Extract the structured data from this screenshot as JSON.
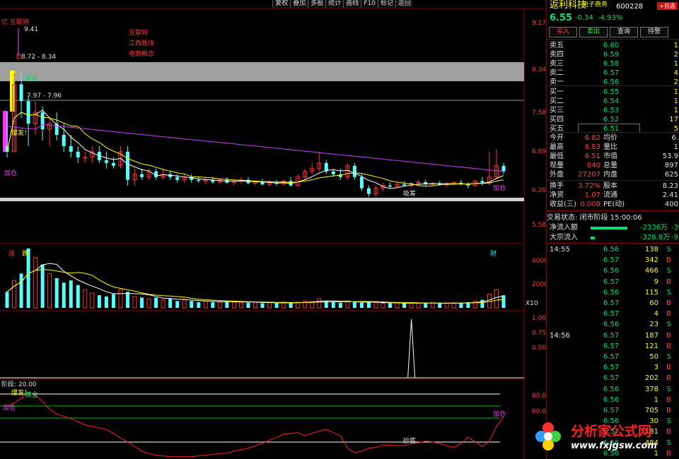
{
  "chart": {
    "site_title": "亿 互联网",
    "concepts": [
      "互联网",
      "江西板块",
      "电商概念"
    ],
    "price_high_label": "9.41",
    "range1": "8.72 - 8.34",
    "range2": "7.97 - 7.96",
    "marker_rise_tag": "涨",
    "marker_fall_tag": "跌",
    "marker_fin_tag": "财",
    "signal_explode": "爆发！",
    "signal_add": "加仓",
    "signal_absorb": "吸筹",
    "signal_gold": "黄金",
    "signal_bottom": "抄底",
    "osc_title": "阶段: 20.00",
    "vol_unit": "X10",
    "price_ticks": [
      "9.17",
      "8.34",
      "7.58",
      "6.89",
      "6.20",
      "5.58"
    ],
    "vol_ticks": [
      "40000",
      "20000"
    ],
    "ind_ticks": [
      "1.00",
      "0.75",
      "0.50"
    ],
    "osc_ticks": [
      "80.00",
      "60.00"
    ],
    "colors": {
      "up": "#ff3232",
      "down": "#54ffff",
      "ma5": "#ffffff",
      "ma10": "#ffff00",
      "ma60": "#cc40ff",
      "border": "#8b0000"
    }
  },
  "chart_data": {
    "type": "candlestick",
    "candles": [
      [
        7.0,
        7.6,
        6.8,
        6.9
      ],
      [
        6.9,
        8.3,
        6.9,
        8.1
      ],
      [
        8.1,
        8.3,
        7.5,
        7.8
      ],
      [
        7.8,
        7.9,
        7.0,
        7.4
      ],
      [
        7.4,
        7.8,
        7.2,
        7.6
      ],
      [
        7.6,
        7.7,
        7.1,
        7.3
      ],
      [
        7.3,
        7.5,
        7.0,
        7.4
      ],
      [
        7.4,
        7.6,
        7.1,
        7.2
      ],
      [
        7.2,
        7.4,
        6.9,
        7.0
      ],
      [
        7.0,
        7.2,
        6.8,
        6.9
      ],
      [
        6.9,
        7.0,
        6.7,
        6.8
      ],
      [
        6.8,
        6.9,
        6.7,
        6.8
      ],
      [
        6.8,
        7.0,
        6.7,
        6.9
      ],
      [
        6.9,
        7.0,
        6.7,
        6.75
      ],
      [
        6.75,
        6.9,
        6.6,
        6.7
      ],
      [
        6.7,
        6.8,
        6.6,
        6.65
      ],
      [
        6.65,
        7.0,
        6.6,
        6.9
      ],
      [
        6.9,
        7.0,
        6.3,
        6.4
      ],
      [
        6.4,
        6.6,
        6.3,
        6.5
      ],
      [
        6.5,
        6.6,
        6.4,
        6.45
      ],
      [
        6.45,
        6.6,
        6.4,
        6.55
      ],
      [
        6.55,
        6.6,
        6.4,
        6.45
      ],
      [
        6.45,
        6.6,
        6.4,
        6.5
      ],
      [
        6.5,
        6.55,
        6.4,
        6.45
      ],
      [
        6.45,
        6.5,
        6.35,
        6.4
      ],
      [
        6.4,
        6.5,
        6.35,
        6.45
      ],
      [
        6.45,
        6.5,
        6.35,
        6.4
      ],
      [
        6.4,
        6.45,
        6.35,
        6.38
      ],
      [
        6.38,
        6.45,
        6.32,
        6.4
      ],
      [
        6.4,
        6.45,
        6.33,
        6.36
      ],
      [
        6.36,
        6.42,
        6.32,
        6.4
      ],
      [
        6.4,
        6.45,
        6.33,
        6.35
      ],
      [
        6.35,
        6.42,
        6.3,
        6.38
      ],
      [
        6.38,
        6.45,
        6.33,
        6.4
      ],
      [
        6.4,
        6.45,
        6.32,
        6.34
      ],
      [
        6.34,
        6.4,
        6.3,
        6.37
      ],
      [
        6.37,
        6.42,
        6.3,
        6.32
      ],
      [
        6.32,
        6.4,
        6.28,
        6.35
      ],
      [
        6.35,
        6.4,
        6.3,
        6.33
      ],
      [
        6.33,
        6.4,
        6.3,
        6.38
      ],
      [
        6.38,
        6.45,
        6.28,
        6.3
      ],
      [
        6.3,
        6.5,
        6.28,
        6.45
      ],
      [
        6.45,
        6.6,
        6.4,
        6.55
      ],
      [
        6.55,
        6.7,
        6.5,
        6.6
      ],
      [
        6.6,
        6.9,
        6.55,
        6.7
      ],
      [
        6.7,
        6.75,
        6.5,
        6.55
      ],
      [
        6.55,
        6.6,
        6.45,
        6.5
      ],
      [
        6.5,
        6.6,
        6.4,
        6.45
      ],
      [
        6.45,
        6.7,
        6.4,
        6.65
      ],
      [
        6.65,
        6.7,
        6.4,
        6.45
      ],
      [
        6.45,
        6.5,
        6.2,
        6.25
      ],
      [
        6.25,
        6.3,
        6.1,
        6.15
      ],
      [
        6.15,
        6.3,
        6.1,
        6.25
      ],
      [
        6.25,
        6.35,
        6.2,
        6.3
      ],
      [
        6.3,
        6.35,
        6.25,
        6.28
      ],
      [
        6.28,
        6.35,
        6.25,
        6.32
      ],
      [
        6.32,
        6.38,
        6.28,
        6.3
      ],
      [
        6.3,
        6.36,
        6.26,
        6.34
      ],
      [
        6.34,
        6.4,
        6.3,
        6.36
      ],
      [
        6.36,
        6.4,
        6.3,
        6.32
      ],
      [
        6.32,
        6.36,
        6.28,
        6.34
      ],
      [
        6.34,
        6.38,
        6.3,
        6.31
      ],
      [
        6.31,
        6.36,
        6.27,
        6.33
      ],
      [
        6.33,
        6.38,
        6.3,
        6.35
      ],
      [
        6.35,
        6.4,
        6.3,
        6.32
      ],
      [
        6.32,
        6.36,
        6.25,
        6.3
      ],
      [
        6.3,
        6.4,
        6.28,
        6.38
      ],
      [
        6.38,
        6.45,
        6.3,
        6.35
      ],
      [
        6.35,
        6.9,
        6.3,
        6.45
      ],
      [
        6.45,
        6.95,
        6.4,
        6.65
      ],
      [
        6.65,
        6.7,
        6.5,
        6.55
      ]
    ],
    "ylim": [
      5.58,
      9.41
    ],
    "volumes": [
      14000,
      24000,
      30000,
      52000,
      44000,
      38000,
      30000,
      26000,
      22000,
      24000,
      20000,
      16000,
      13000,
      11000,
      10000,
      12000,
      16000,
      14000,
      10000,
      9000,
      8000,
      9000,
      7000,
      8000,
      6000,
      7000,
      6000,
      5000,
      6000,
      5000,
      5000,
      6000,
      5000,
      5000,
      4500,
      5000,
      4000,
      4500,
      4000,
      5000,
      4000,
      5000,
      6000,
      5500,
      8000,
      6000,
      5000,
      4500,
      6000,
      5000,
      4500,
      5000,
      4500,
      4000,
      4000,
      4500,
      4000,
      4500,
      4000,
      4000,
      4500,
      4000,
      4000,
      4500,
      4000,
      5000,
      6000,
      7000,
      12000,
      16000,
      11000
    ],
    "vol_ylim": [
      0,
      50000
    ],
    "indicator": [
      0,
      0,
      0,
      0,
      0,
      0,
      0,
      0,
      0,
      0,
      0,
      0,
      0,
      0,
      0,
      0,
      0,
      0,
      0,
      0,
      0,
      0,
      0,
      0,
      0,
      0,
      0,
      0,
      0,
      0,
      0,
      0,
      0,
      0,
      0,
      0,
      0,
      0,
      0,
      0,
      0,
      0,
      0,
      0,
      0,
      0,
      0,
      0,
      0,
      0,
      0,
      0,
      0,
      0,
      0,
      0,
      0,
      1,
      0,
      0,
      0,
      0,
      0,
      0,
      0,
      0,
      0,
      0,
      0,
      0,
      0
    ],
    "ind_ylim": [
      0,
      1.0
    ],
    "oscillator": [
      68,
      72,
      78,
      85,
      82,
      74,
      64,
      58,
      55,
      52,
      48,
      44,
      42,
      40,
      38,
      33,
      27,
      22,
      16,
      10,
      7,
      5,
      4,
      3,
      3,
      3,
      3,
      4,
      5,
      6,
      7,
      8,
      10,
      12,
      14,
      17,
      20,
      24,
      28,
      32,
      33,
      34,
      30,
      33,
      36,
      38,
      34,
      30,
      14,
      8,
      10,
      14,
      15,
      18,
      18,
      17,
      17,
      20,
      21,
      23,
      22,
      20,
      17,
      15,
      20,
      28,
      22,
      16,
      23,
      42,
      54
    ],
    "osc_ylim": [
      0,
      100
    ]
  },
  "panel": {
    "name": "返利科技",
    "code": "600228",
    "tag": "电子商务",
    "add_btn": "+自选",
    "price": "6.55",
    "change": "-0.34",
    "pct": "-4.93%",
    "buttons": [
      "买入",
      "卖出",
      "查询",
      "持警"
    ],
    "asks": [
      [
        "卖五",
        "6.60",
        "1"
      ],
      [
        "卖四",
        "6.59",
        "2"
      ],
      [
        "卖三",
        "6.58",
        "1"
      ],
      [
        "卖二",
        "6.57",
        "4"
      ],
      [
        "卖一",
        "6.56",
        "2"
      ]
    ],
    "bids": [
      [
        "买一",
        "6.55",
        "1"
      ],
      [
        "买二",
        "6.54",
        "1"
      ],
      [
        "买三",
        "6.53",
        "1"
      ],
      [
        "买四",
        "6.52",
        "17"
      ],
      [
        "买五",
        "6.51",
        "5"
      ]
    ],
    "stats": [
      [
        "今开",
        "6.82",
        "均价",
        "6."
      ],
      [
        "最高",
        "6.83",
        "量比",
        "1"
      ],
      [
        "最低",
        "6.51",
        "市值",
        "53.9"
      ],
      [
        "现量",
        "840",
        "总量",
        "897"
      ],
      [
        "外盘",
        "27207",
        "内盘",
        "625"
      ]
    ],
    "stats2": [
      [
        "换手",
        "3.72%",
        "股本",
        "8.23"
      ],
      [
        "净资",
        "1.07",
        "流通",
        "2.41"
      ],
      [
        "收益(三)",
        "0.008",
        "PE(动)",
        "400"
      ]
    ],
    "trade_state": "交易状态: 闭市阶段 15:00:06",
    "netflow_label": "净流入额",
    "netflow_val": "-2336万",
    "netflow_tail": "-39",
    "block_label": "大宗流入",
    "block_val": "-326.8万",
    "block_tail": "-9",
    "ticks": [
      [
        "14:55",
        "6.56",
        "138",
        "S"
      ],
      [
        "",
        "6.57",
        "342",
        "B"
      ],
      [
        "",
        "6.56",
        "466",
        "S"
      ],
      [
        "",
        "6.57",
        "9",
        "B"
      ],
      [
        "",
        "6.56",
        "115",
        "S"
      ],
      [
        "",
        "6.57",
        "60",
        "B"
      ],
      [
        "",
        "6.57",
        "4",
        "B"
      ],
      [
        "",
        "6.56",
        "23",
        "S"
      ],
      [
        "14:56",
        "6.57",
        "187",
        "B"
      ],
      [
        "",
        "6.57",
        "121",
        "B"
      ],
      [
        "",
        "6.57",
        "50",
        "S"
      ],
      [
        "",
        "6.57",
        "3",
        "B"
      ],
      [
        "",
        "6.57",
        "202",
        "B"
      ],
      [
        "",
        "6.56",
        "378",
        "S"
      ],
      [
        "",
        "6.56",
        "1",
        "B"
      ],
      [
        "",
        "6.57",
        "705",
        "B"
      ],
      [
        "",
        "6.56",
        "30",
        "S"
      ],
      [
        "",
        "6.57",
        "181",
        "B"
      ],
      [
        "",
        "6.56",
        "484",
        "S"
      ],
      [
        "",
        "6.56",
        "1",
        "B"
      ]
    ]
  },
  "toolbar": [
    "复权",
    "叠加",
    "多股",
    "统计",
    "画线",
    "F10",
    "标记",
    "返回"
  ],
  "logo": {
    "text": "分析家公式网",
    "url": "www.fxjgsw.com"
  }
}
